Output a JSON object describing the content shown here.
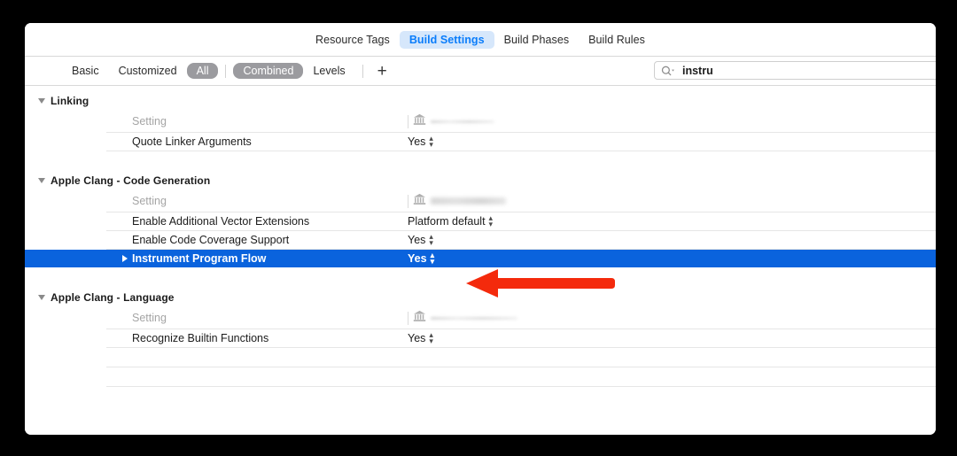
{
  "window": {
    "title_tabs": [
      {
        "label": "Resource Tags",
        "active": false
      },
      {
        "label": "Build Settings",
        "active": true
      },
      {
        "label": "Build Phases",
        "active": false
      },
      {
        "label": "Build Rules",
        "active": false
      }
    ]
  },
  "filterbar": {
    "basic": "Basic",
    "customized": "Customized",
    "all": "All",
    "combined": "Combined",
    "levels": "Levels",
    "add": "+"
  },
  "search": {
    "value": "instru",
    "placeholder": "",
    "icon": "search-icon"
  },
  "columns": {
    "setting": "Setting",
    "target": ""
  },
  "groups": [
    {
      "title": "Linking",
      "rows": [
        {
          "name": "Quote Linker Arguments",
          "value": "Yes",
          "selected": false,
          "stepper": true
        }
      ]
    },
    {
      "title": "Apple Clang - Code Generation",
      "rows": [
        {
          "name": "Enable Additional Vector Extensions",
          "value": "Platform default",
          "selected": false,
          "stepper": true
        },
        {
          "name": "Enable Code Coverage Support",
          "value": "Yes",
          "selected": false,
          "stepper": true
        },
        {
          "name": "Instrument Program Flow",
          "value": "Yes",
          "selected": true,
          "stepper": true,
          "expandable": true
        }
      ]
    },
    {
      "title": "Apple Clang - Language",
      "rows": [
        {
          "name": "Recognize Builtin Functions",
          "value": "Yes",
          "selected": false,
          "stepper": true
        }
      ]
    }
  ],
  "annotation": {
    "type": "arrow",
    "direction": "left",
    "color": "#f42a0c",
    "points_at": "Instrument Program Flow"
  },
  "colors": {
    "selection_blue": "#0a63dd",
    "tab_active_bg": "#d6e7fb",
    "tab_active_text": "#0a7dfb",
    "filter_selected_bg": "#9b9b9f",
    "annotation_red": "#f42a0c",
    "backdrop": "#000000"
  }
}
